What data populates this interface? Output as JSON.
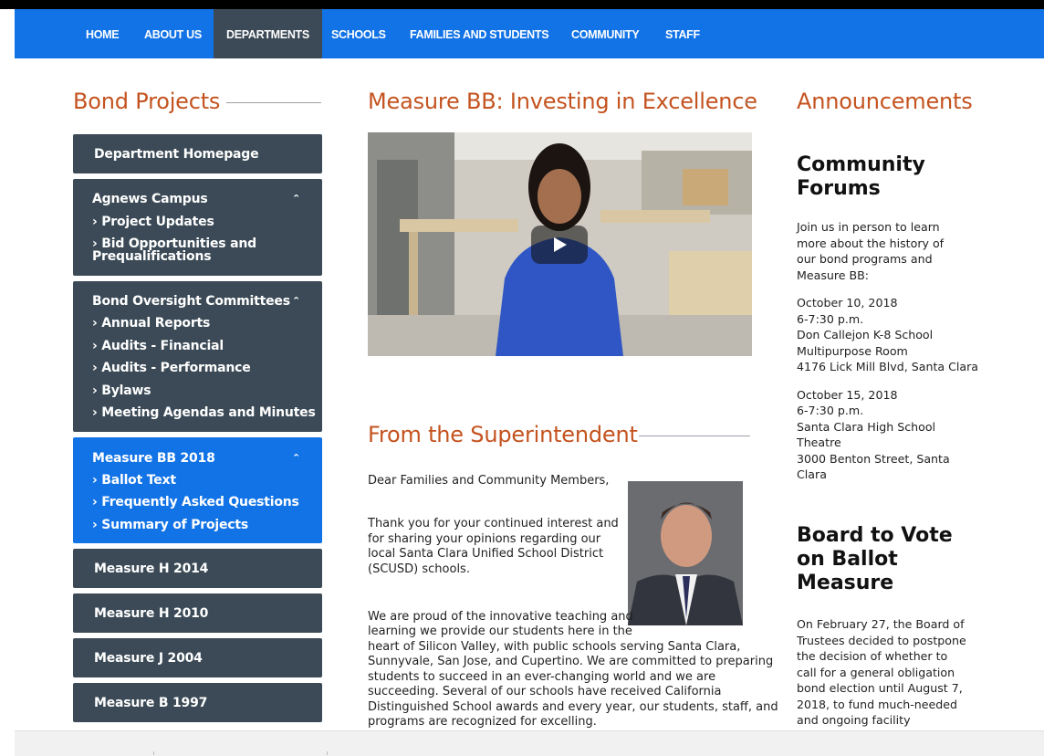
{
  "nav": {
    "items": [
      "HOME",
      "ABOUT US",
      "DEPARTMENTS",
      "SCHOOLS",
      "FAMILIES AND STUDENTS",
      "COMMUNITY",
      "STAFF"
    ],
    "active": "DEPARTMENTS",
    "color": "#1273e6",
    "active_color": "#3b4a56"
  },
  "sidebar": {
    "title": "Bond Projects",
    "homepage": "Department Homepage",
    "groups": [
      {
        "label": "Agnews Campus",
        "icon": "chevron-up-icon",
        "items": [
          "Project Updates",
          "Bid Opportunities and Prequalifications"
        ]
      },
      {
        "label": "Bond Oversight Committees",
        "icon": "chevron-up-icon",
        "items": [
          "Annual Reports",
          "Audits - Financial",
          "Audits - Performance",
          "Bylaws",
          "Meeting Agendas and Minutes"
        ]
      },
      {
        "label": "Measure BB 2018",
        "icon": "chevron-up-icon",
        "active": true,
        "items": [
          "Ballot Text",
          "Frequently Asked Questions",
          "Summary of Projects"
        ]
      }
    ],
    "links": [
      "Measure H 2014",
      "Measure H 2010",
      "Measure J 2004",
      "Measure B 1997"
    ]
  },
  "main": {
    "video_title": "Measure BB: Investing in Excellence",
    "video_icon": "play-icon",
    "superintendent_title": "From the Superintendent",
    "greeting": "Dear Families and Community Members,",
    "para1": "Thank you for your continued interest and for sharing your opinions regarding our local Santa Clara Unified School District (SCUSD) schools.",
    "para2_lines": [
      "We are proud of the innovative teaching and",
      "learning we provide our students here in the",
      "heart of Silicon Valley, with public schools serving Santa Clara,",
      "Sunnyvale, San Jose, and Cupertino. We are committed to preparing",
      "students to succeed in an ever-changing world and we are",
      "succeeding. Several of our schools have received California",
      "Distinguished School awards and every year, our students, staff, and",
      "programs are recognized for excelling."
    ]
  },
  "announcements": {
    "title": "Announcements",
    "forums": {
      "heading": "Community Forums",
      "intro": "Join us in person to learn more about the history of our bond programs and Measure BB:",
      "event1": [
        "October 10, 2018",
        "6-7:30 p.m.",
        "Don Callejon K-8 School",
        "Multipurpose Room",
        "4176 Lick Mill Blvd, Santa Clara"
      ],
      "event2": [
        "October 15, 2018",
        "6-7:30 p.m.",
        "Santa Clara High School",
        "Theatre",
        "3000 Benton Street, Santa",
        "Clara"
      ]
    },
    "board": {
      "heading": "Board to Vote on Ballot Measure",
      "text": "On February 27, the Board of Trustees decided to postpone the decision of whether to call for a general obligation bond election until August 7, 2018, to fund much-needed and ongoing facility"
    }
  }
}
